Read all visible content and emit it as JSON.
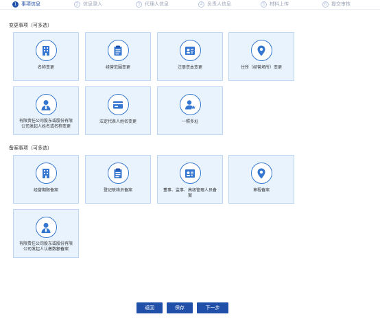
{
  "steps": [
    {
      "num": "1",
      "label": "事项信息",
      "active": true
    },
    {
      "num": "2",
      "label": "信息录入"
    },
    {
      "num": "3",
      "label": "代理人信息"
    },
    {
      "num": "4",
      "label": "负责人信息"
    },
    {
      "num": "5",
      "label": "材料上传"
    },
    {
      "num": "6",
      "label": "提交审核"
    }
  ],
  "change_section": {
    "title": "变更事项（可多选）",
    "items": [
      {
        "label": "名称变更",
        "icon": "building-icon"
      },
      {
        "label": "经营范围变更",
        "icon": "clipboard-icon"
      },
      {
        "label": "注册资本变更",
        "icon": "id-card-icon"
      },
      {
        "label": "住所（经营场所）变更",
        "icon": "location-pin-icon"
      },
      {
        "label": "有限责任公司股东或股份有限公司发起人姓名或名称变更",
        "icon": "person-icon"
      },
      {
        "label": "法定代表人姓名变更",
        "icon": "card-icon"
      },
      {
        "label": "一照多址",
        "icon": "user-star-icon"
      }
    ]
  },
  "filing_section": {
    "title": "备案事项（可多选）",
    "items": [
      {
        "label": "经营期限备案",
        "icon": "building-icon"
      },
      {
        "label": "登记联络员备案",
        "icon": "clipboard-icon"
      },
      {
        "label": "董事、监事、高级管理人员备案",
        "icon": "id-card-icon"
      },
      {
        "label": "章程备案",
        "icon": "location-pin-icon"
      },
      {
        "label": "有限责任公司股东或股份有限公司发起人认缴数额备案",
        "icon": "person-icon"
      }
    ]
  },
  "buttons": {
    "back": "返回",
    "save": "保存",
    "next": "下一步"
  },
  "colors": {
    "primary": "#1f4fa8",
    "icon_blue": "#3577d0",
    "card_bg": "#e8f3fe",
    "card_border": "#bcd6f4"
  }
}
